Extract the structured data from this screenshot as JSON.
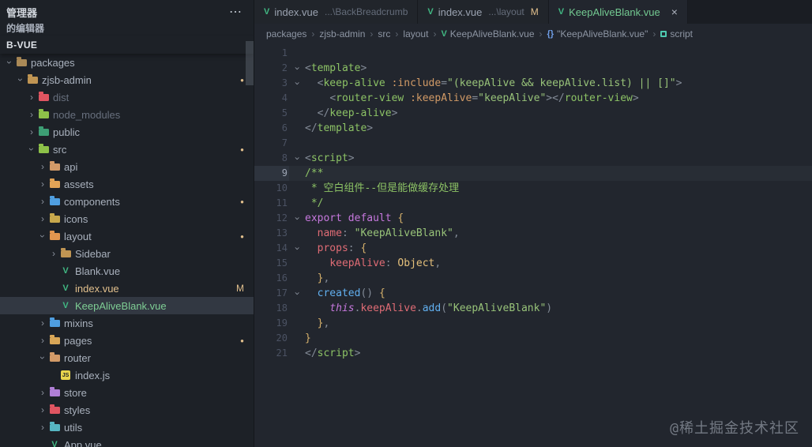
{
  "colors": {
    "bg-editor": "#22262e",
    "bg-sidebar": "#1d2127",
    "bg-tabbar": "#1a1d23",
    "bg-tab-inactive": "#21252b",
    "bg-tree-selected": "#323842",
    "fg-default": "#abb2bf",
    "accent-vue": "#41b883",
    "git-modified": "#e2c08d",
    "git-untracked": "#73c991",
    "tok-punct": "#838b97",
    "tok-tag": "#8cc265",
    "tok-attr": "#d19a66",
    "tok-string": "#98c379",
    "tok-comment": "#8cc265",
    "tok-keyword": "#c678dd",
    "tok-prop": "#e06c75",
    "tok-fn": "#61afef",
    "tok-class": "#e5c07b",
    "tok-brace": "#d5b06b",
    "line-number": "#4b5263",
    "line-number-active": "#9da5b4"
  },
  "sidebar": {
    "title": "管理器",
    "more_label": "⋯",
    "open_editors_label": "的编辑器",
    "workspace_label": "B-VUE",
    "tree": [
      {
        "label": "packages",
        "type": "folder",
        "icon": "folder",
        "icon_color": "#ab8a57",
        "indent": 1,
        "expanded": true
      },
      {
        "label": "zjsb-admin",
        "type": "folder",
        "icon": "folder",
        "icon_color": "#c09553",
        "indent": 2,
        "expanded": true,
        "badge": "dot"
      },
      {
        "label": "dist",
        "type": "folder",
        "icon": "folder",
        "icon_color": "#e05561",
        "indent": 3,
        "expanded": false,
        "dim": true
      },
      {
        "label": "node_modules",
        "type": "folder",
        "icon": "folder",
        "icon_color": "#8dc149",
        "indent": 3,
        "expanded": false,
        "dim": true
      },
      {
        "label": "public",
        "type": "folder",
        "icon": "folder",
        "icon_color": "#3d9e74",
        "indent": 3,
        "expanded": false
      },
      {
        "label": "src",
        "type": "folder",
        "icon": "folder",
        "icon_color": "#8dc149",
        "indent": 3,
        "expanded": true,
        "badge": "dot"
      },
      {
        "label": "api",
        "type": "folder",
        "icon": "folder",
        "icon_color": "#d29a68",
        "indent": 4,
        "expanded": false
      },
      {
        "label": "assets",
        "type": "folder",
        "icon": "folder",
        "icon_color": "#e2a356",
        "indent": 4,
        "expanded": false
      },
      {
        "label": "components",
        "type": "folder",
        "icon": "folder",
        "icon_color": "#4f9ee0",
        "indent": 4,
        "expanded": false,
        "badge": "dot"
      },
      {
        "label": "icons",
        "type": "folder",
        "icon": "folder",
        "icon_color": "#c7a84c",
        "indent": 4,
        "expanded": false
      },
      {
        "label": "layout",
        "type": "folder",
        "icon": "folder",
        "icon_color": "#e2954f",
        "indent": 4,
        "expanded": true,
        "badge": "dot"
      },
      {
        "label": "Sidebar",
        "type": "folder",
        "icon": "folder",
        "icon_color": "#c09553",
        "indent": 5,
        "expanded": false
      },
      {
        "label": "Blank.vue",
        "type": "file",
        "icon": "vue",
        "indent": 5
      },
      {
        "label": "index.vue",
        "type": "file",
        "icon": "vue",
        "indent": 5,
        "color": "#e2c08d",
        "badge": "M"
      },
      {
        "label": "KeepAliveBlank.vue",
        "type": "file",
        "icon": "vue",
        "indent": 5,
        "color": "#7fcf95",
        "selected": true
      },
      {
        "label": "mixins",
        "type": "folder",
        "icon": "folder",
        "icon_color": "#4f9ee0",
        "indent": 4,
        "expanded": false
      },
      {
        "label": "pages",
        "type": "folder",
        "icon": "folder",
        "icon_color": "#d8a657",
        "indent": 4,
        "expanded": false,
        "badge": "dot"
      },
      {
        "label": "router",
        "type": "folder",
        "icon": "folder",
        "icon_color": "#d29a68",
        "indent": 4,
        "expanded": true
      },
      {
        "label": "index.js",
        "type": "file",
        "icon": "js",
        "indent": 5
      },
      {
        "label": "store",
        "type": "folder",
        "icon": "folder",
        "icon_color": "#b07fd6",
        "indent": 4,
        "expanded": false
      },
      {
        "label": "styles",
        "type": "folder",
        "icon": "folder",
        "icon_color": "#e05561",
        "indent": 4,
        "expanded": false
      },
      {
        "label": "utils",
        "type": "folder",
        "icon": "folder",
        "icon_color": "#56b6c2",
        "indent": 4,
        "expanded": false
      },
      {
        "label": "App.vue",
        "type": "file",
        "icon": "vue",
        "indent": 4
      }
    ]
  },
  "tabs": [
    {
      "icon": "vue",
      "label": "index.vue",
      "description": "...\\BackBreadcrumb",
      "active": false
    },
    {
      "icon": "vue",
      "label": "index.vue",
      "description": "...\\layout",
      "badge": "M",
      "active": false
    },
    {
      "icon": "vue",
      "label": "KeepAliveBlank.vue",
      "label_color": "#73c991",
      "close": "×",
      "active": true
    }
  ],
  "breadcrumb": {
    "separator": "›",
    "items": [
      {
        "label": "packages"
      },
      {
        "label": "zjsb-admin"
      },
      {
        "label": "src"
      },
      {
        "label": "layout"
      },
      {
        "icon": "vue",
        "label": "KeepAliveBlank.vue"
      },
      {
        "icon": "braces",
        "label": "\"KeepAliveBlank.vue\""
      },
      {
        "icon": "module",
        "label": "script"
      }
    ]
  },
  "editor": {
    "current_line": 9,
    "lines": [
      {
        "n": 1,
        "tokens": []
      },
      {
        "n": 2,
        "fold": true,
        "tokens": [
          {
            "c": "pu",
            "t": "<"
          },
          {
            "c": "tg",
            "t": "template"
          },
          {
            "c": "pu",
            "t": ">"
          }
        ]
      },
      {
        "n": 3,
        "fold": true,
        "tokens": [
          {
            "c": "pl",
            "t": "  "
          },
          {
            "c": "pu",
            "t": "<"
          },
          {
            "c": "tg",
            "t": "keep-alive"
          },
          {
            "c": "pl",
            "t": " "
          },
          {
            "c": "at",
            "t": ":include"
          },
          {
            "c": "pu",
            "t": "="
          },
          {
            "c": "st",
            "t": "\"(keepAlive && keepAlive.list) || []\""
          },
          {
            "c": "pu",
            "t": ">"
          }
        ]
      },
      {
        "n": 4,
        "tokens": [
          {
            "c": "pl",
            "t": "    "
          },
          {
            "c": "pu",
            "t": "<"
          },
          {
            "c": "tg",
            "t": "router-view"
          },
          {
            "c": "pl",
            "t": " "
          },
          {
            "c": "at",
            "t": ":keepAlive"
          },
          {
            "c": "pu",
            "t": "="
          },
          {
            "c": "st",
            "t": "\"keepAlive\""
          },
          {
            "c": "pu",
            "t": "></"
          },
          {
            "c": "tg",
            "t": "router-view"
          },
          {
            "c": "pu",
            "t": ">"
          }
        ]
      },
      {
        "n": 5,
        "tokens": [
          {
            "c": "pl",
            "t": "  "
          },
          {
            "c": "pu",
            "t": "</"
          },
          {
            "c": "tg",
            "t": "keep-alive"
          },
          {
            "c": "pu",
            "t": ">"
          }
        ]
      },
      {
        "n": 6,
        "tokens": [
          {
            "c": "pu",
            "t": "</"
          },
          {
            "c": "tg",
            "t": "template"
          },
          {
            "c": "pu",
            "t": ">"
          }
        ]
      },
      {
        "n": 7,
        "tokens": []
      },
      {
        "n": 8,
        "fold": true,
        "tokens": [
          {
            "c": "pu",
            "t": "<"
          },
          {
            "c": "tg",
            "t": "script"
          },
          {
            "c": "pu",
            "t": ">"
          }
        ]
      },
      {
        "n": 9,
        "tokens": [
          {
            "c": "cm",
            "t": "/**"
          }
        ]
      },
      {
        "n": 10,
        "tokens": [
          {
            "c": "cm",
            "t": " * 空白组件--但是能做缓存处理"
          }
        ]
      },
      {
        "n": 11,
        "tokens": [
          {
            "c": "cm",
            "t": " */"
          }
        ]
      },
      {
        "n": 12,
        "fold": true,
        "tokens": [
          {
            "c": "kw",
            "t": "export"
          },
          {
            "c": "pl",
            "t": " "
          },
          {
            "c": "kw",
            "t": "default"
          },
          {
            "c": "pl",
            "t": " "
          },
          {
            "c": "br",
            "t": "{"
          }
        ]
      },
      {
        "n": 13,
        "tokens": [
          {
            "c": "pl",
            "t": "  "
          },
          {
            "c": "pr",
            "t": "name"
          },
          {
            "c": "pu",
            "t": ":"
          },
          {
            "c": "pl",
            "t": " "
          },
          {
            "c": "st",
            "t": "\"KeepAliveBlank\""
          },
          {
            "c": "pu",
            "t": ","
          }
        ]
      },
      {
        "n": 14,
        "fold": true,
        "tokens": [
          {
            "c": "pl",
            "t": "  "
          },
          {
            "c": "pr",
            "t": "props"
          },
          {
            "c": "pu",
            "t": ":"
          },
          {
            "c": "pl",
            "t": " "
          },
          {
            "c": "br",
            "t": "{"
          }
        ]
      },
      {
        "n": 15,
        "tokens": [
          {
            "c": "pl",
            "t": "    "
          },
          {
            "c": "pr",
            "t": "keepAlive"
          },
          {
            "c": "pu",
            "t": ":"
          },
          {
            "c": "pl",
            "t": " "
          },
          {
            "c": "cl",
            "t": "Object"
          },
          {
            "c": "pu",
            "t": ","
          }
        ]
      },
      {
        "n": 16,
        "tokens": [
          {
            "c": "pl",
            "t": "  "
          },
          {
            "c": "br",
            "t": "}"
          },
          {
            "c": "pu",
            "t": ","
          }
        ]
      },
      {
        "n": 17,
        "fold": true,
        "tokens": [
          {
            "c": "pl",
            "t": "  "
          },
          {
            "c": "fn",
            "t": "created"
          },
          {
            "c": "pu",
            "t": "()"
          },
          {
            "c": "pl",
            "t": " "
          },
          {
            "c": "br",
            "t": "{"
          }
        ]
      },
      {
        "n": 18,
        "tokens": [
          {
            "c": "pl",
            "t": "    "
          },
          {
            "c": "th",
            "t": "this"
          },
          {
            "c": "pu",
            "t": "."
          },
          {
            "c": "pr",
            "t": "keepAlive"
          },
          {
            "c": "pu",
            "t": "."
          },
          {
            "c": "fn",
            "t": "add"
          },
          {
            "c": "pu",
            "t": "("
          },
          {
            "c": "st",
            "t": "\"KeepAliveBlank\""
          },
          {
            "c": "pu",
            "t": ")"
          }
        ]
      },
      {
        "n": 19,
        "tokens": [
          {
            "c": "pl",
            "t": "  "
          },
          {
            "c": "br",
            "t": "}"
          },
          {
            "c": "pu",
            "t": ","
          }
        ]
      },
      {
        "n": 20,
        "tokens": [
          {
            "c": "br",
            "t": "}"
          }
        ]
      },
      {
        "n": 21,
        "tokens": [
          {
            "c": "pu",
            "t": "</"
          },
          {
            "c": "tg",
            "t": "script"
          },
          {
            "c": "pu",
            "t": ">"
          }
        ]
      }
    ]
  },
  "watermark": "@稀土掘金技术社区"
}
